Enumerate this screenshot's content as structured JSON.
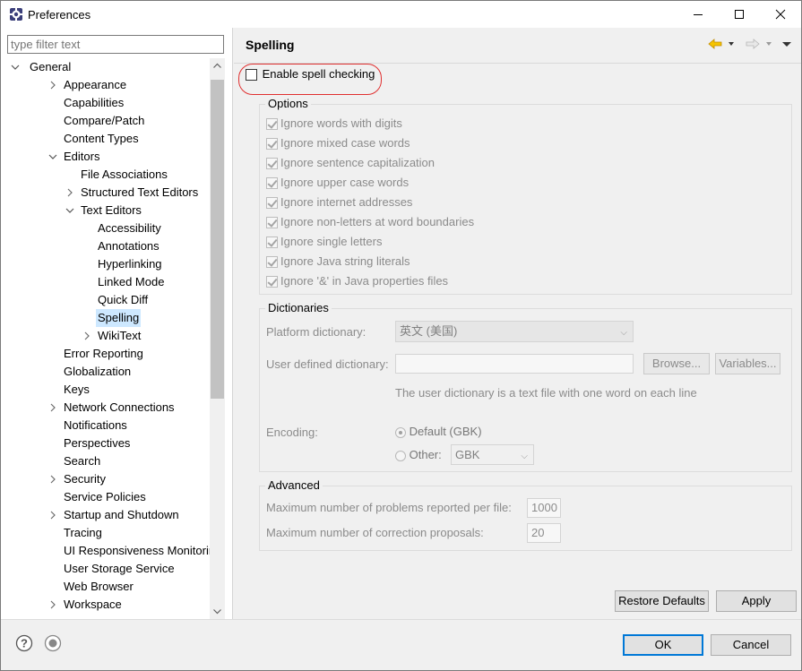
{
  "window": {
    "title": "Preferences"
  },
  "filter": {
    "placeholder": "type filter text"
  },
  "tree": [
    {
      "label": "General",
      "level": 0,
      "twisty": "open"
    },
    {
      "label": "Appearance",
      "level": 1,
      "twisty": "closed"
    },
    {
      "label": "Capabilities",
      "level": 1,
      "twisty": ""
    },
    {
      "label": "Compare/Patch",
      "level": 1,
      "twisty": ""
    },
    {
      "label": "Content Types",
      "level": 1,
      "twisty": ""
    },
    {
      "label": "Editors",
      "level": 1,
      "twisty": "open"
    },
    {
      "label": "File Associations",
      "level": 2,
      "twisty": ""
    },
    {
      "label": "Structured Text Editors",
      "level": 2,
      "twisty": "closed"
    },
    {
      "label": "Text Editors",
      "level": 2,
      "twisty": "open"
    },
    {
      "label": "Accessibility",
      "level": 3,
      "twisty": ""
    },
    {
      "label": "Annotations",
      "level": 3,
      "twisty": ""
    },
    {
      "label": "Hyperlinking",
      "level": 3,
      "twisty": ""
    },
    {
      "label": "Linked Mode",
      "level": 3,
      "twisty": ""
    },
    {
      "label": "Quick Diff",
      "level": 3,
      "twisty": ""
    },
    {
      "label": "Spelling",
      "level": 3,
      "twisty": "",
      "selected": true
    },
    {
      "label": "WikiText",
      "level": 3,
      "twisty": "closed"
    },
    {
      "label": "Error Reporting",
      "level": 1,
      "twisty": ""
    },
    {
      "label": "Globalization",
      "level": 1,
      "twisty": ""
    },
    {
      "label": "Keys",
      "level": 1,
      "twisty": ""
    },
    {
      "label": "Network Connections",
      "level": 1,
      "twisty": "closed"
    },
    {
      "label": "Notifications",
      "level": 1,
      "twisty": ""
    },
    {
      "label": "Perspectives",
      "level": 1,
      "twisty": ""
    },
    {
      "label": "Search",
      "level": 1,
      "twisty": ""
    },
    {
      "label": "Security",
      "level": 1,
      "twisty": "closed"
    },
    {
      "label": "Service Policies",
      "level": 1,
      "twisty": ""
    },
    {
      "label": "Startup and Shutdown",
      "level": 1,
      "twisty": "closed"
    },
    {
      "label": "Tracing",
      "level": 1,
      "twisty": ""
    },
    {
      "label": "UI Responsiveness Monitoring",
      "level": 1,
      "twisty": ""
    },
    {
      "label": "User Storage Service",
      "level": 1,
      "twisty": ""
    },
    {
      "label": "Web Browser",
      "level": 1,
      "twisty": ""
    },
    {
      "label": "Workspace",
      "level": 1,
      "twisty": "closed"
    }
  ],
  "page": {
    "title": "Spelling",
    "enable_label": "Enable spell checking",
    "enable_checked": false
  },
  "options": {
    "title": "Options",
    "items": [
      "Ignore words with digits",
      "Ignore mixed case words",
      "Ignore sentence capitalization",
      "Ignore upper case words",
      "Ignore internet addresses",
      "Ignore non-letters at word boundaries",
      "Ignore single letters",
      "Ignore Java string literals",
      "Ignore '&' in Java properties files"
    ]
  },
  "dictionaries": {
    "title": "Dictionaries",
    "platform_label": "Platform dictionary:",
    "platform_value": "英文 (美国)",
    "user_label": "User defined dictionary:",
    "user_value": "",
    "browse_label": "Browse...",
    "variables_label": "Variables...",
    "hint": "The user dictionary is a text file with one word on each line",
    "encoding_label": "Encoding:",
    "default_label": "Default (GBK)",
    "other_label": "Other:",
    "other_value": "GBK"
  },
  "advanced": {
    "title": "Advanced",
    "max_problems_label": "Maximum number of problems reported per file:",
    "max_problems_value": "1000",
    "max_proposals_label": "Maximum number of correction proposals:",
    "max_proposals_value": "20"
  },
  "buttons": {
    "restore": "Restore Defaults",
    "apply": "Apply",
    "ok": "OK",
    "cancel": "Cancel"
  },
  "colors": {
    "selection": "#cde8ff",
    "highlight_ring": "#e03030",
    "default_button_border": "#0078d7",
    "nav_arrow": "#e8a400"
  }
}
